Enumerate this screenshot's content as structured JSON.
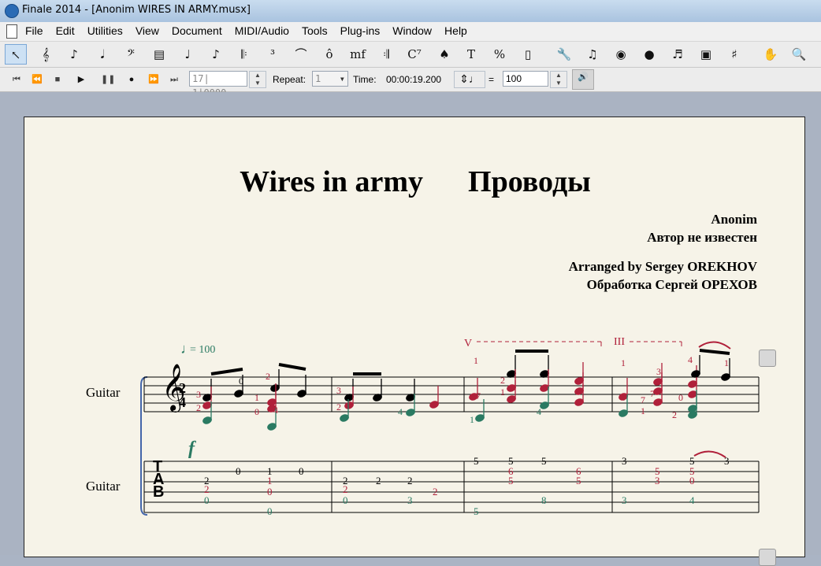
{
  "window": {
    "title": "Finale 2014 - [Anonim WIRES IN ARMY.musx]"
  },
  "menu": [
    "File",
    "Edit",
    "Utilities",
    "View",
    "Document",
    "MIDI/Audio",
    "Tools",
    "Plug-ins",
    "Window",
    "Help"
  ],
  "toolbar": {
    "tools": [
      {
        "name": "selection-tool",
        "glyph": "↖"
      },
      {
        "name": "staff-tool",
        "glyph": "𝄞"
      },
      {
        "name": "simple-entry-tool",
        "glyph": "♪"
      },
      {
        "name": "speedy-entry-tool",
        "glyph": "𝅘𝅥"
      },
      {
        "name": "clef-tool",
        "glyph": "𝄢"
      },
      {
        "name": "measure-tool",
        "glyph": "▤"
      },
      {
        "name": "note-tool",
        "glyph": "♩"
      },
      {
        "name": "articulation-tool",
        "glyph": "♪"
      },
      {
        "name": "repeat-tool",
        "glyph": "𝄆"
      },
      {
        "name": "tuplet-tool",
        "glyph": "³"
      },
      {
        "name": "smart-shape-tool",
        "glyph": "⌒"
      },
      {
        "name": "articulation-tool-2",
        "glyph": "ô"
      },
      {
        "name": "expression-tool",
        "glyph": "mf"
      },
      {
        "name": "repeat-bar-tool",
        "glyph": "𝄇"
      },
      {
        "name": "chord-tool",
        "glyph": "C⁷"
      },
      {
        "name": "lyrics-tool",
        "glyph": "♠"
      },
      {
        "name": "text-tool",
        "glyph": "T"
      },
      {
        "name": "resize-tool",
        "glyph": "%"
      },
      {
        "name": "page-layout-tool",
        "glyph": "▯"
      },
      {
        "name": "special-tools",
        "glyph": "🔧"
      },
      {
        "name": "midi-tool",
        "glyph": "♫"
      },
      {
        "name": "mirror-tool",
        "glyph": "◉"
      },
      {
        "name": "ossia-tool",
        "glyph": "●"
      },
      {
        "name": "graphics-tool",
        "glyph": "♬"
      },
      {
        "name": "hyperscribe-tool",
        "glyph": "▣"
      },
      {
        "name": "tempo-tool",
        "glyph": "♯"
      },
      {
        "name": "hand-grabber-tool",
        "glyph": "✋"
      },
      {
        "name": "zoom-tool",
        "glyph": "🔍"
      }
    ]
  },
  "playback": {
    "measure_field": "17| 1|0000",
    "repeat_label": "Repeat:",
    "repeat_value": "1",
    "time_label": "Time:",
    "time_value": "00:00:19.200",
    "equals": "=",
    "tempo_value": "100"
  },
  "score": {
    "title": "Wires in army      Проводы",
    "composer": "Anonim",
    "composer_ru": "Автор не известен",
    "arranger": "Arranged by Sergey OREKHOV",
    "arranger_ru": "Обработка Сергей ОРЕХОВ",
    "tempo_mark": "= 100",
    "instrument_staff": "Guitar",
    "instrument_tab": "Guitar",
    "dynamic": "f",
    "time_sig_top": "2",
    "time_sig_bottom": "4",
    "position_v": "V",
    "position_iii": "III",
    "tab_letters": [
      "T",
      "A",
      "B"
    ],
    "tab_numbers": [
      {
        "t": "0",
        "c": "b"
      },
      {
        "t": "1",
        "c": "b"
      },
      {
        "t": "0",
        "c": "b"
      },
      {
        "t": "2",
        "c": "b"
      },
      {
        "t": "2",
        "c": "r"
      },
      {
        "t": "0",
        "c": "g"
      },
      {
        "t": "1",
        "c": "r"
      },
      {
        "t": "0",
        "c": "r"
      },
      {
        "t": "0",
        "c": "g"
      },
      {
        "t": "2",
        "c": "b"
      },
      {
        "t": "2",
        "c": "r"
      },
      {
        "t": "0",
        "c": "g"
      },
      {
        "t": "2",
        "c": "b"
      },
      {
        "t": "2",
        "c": "b"
      },
      {
        "t": "3",
        "c": "g"
      },
      {
        "t": "2",
        "c": "r"
      },
      {
        "t": "5",
        "c": "b"
      },
      {
        "t": "5",
        "c": "g"
      },
      {
        "t": "5",
        "c": "b"
      },
      {
        "t": "6",
        "c": "r"
      },
      {
        "t": "5",
        "c": "r"
      },
      {
        "t": "5",
        "c": "b"
      },
      {
        "t": "8",
        "c": "g"
      },
      {
        "t": "6",
        "c": "r"
      },
      {
        "t": "5",
        "c": "r"
      },
      {
        "t": "3",
        "c": "b"
      },
      {
        "t": "3",
        "c": "g"
      },
      {
        "t": "5",
        "c": "r"
      },
      {
        "t": "3",
        "c": "r"
      },
      {
        "t": "5",
        "c": "b"
      },
      {
        "t": "5",
        "c": "r"
      },
      {
        "t": "0",
        "c": "r"
      },
      {
        "t": "4",
        "c": "g"
      },
      {
        "t": "3",
        "c": "b"
      }
    ],
    "finger_numbers": [
      {
        "t": "0",
        "c": "b"
      },
      {
        "t": "2",
        "c": "r"
      },
      {
        "t": "3",
        "c": "r"
      },
      {
        "t": "2",
        "c": "r"
      },
      {
        "t": "4",
        "c": "r"
      },
      {
        "t": "1",
        "c": "r"
      },
      {
        "t": "0",
        "c": "r"
      },
      {
        "t": "3",
        "c": "r"
      },
      {
        "t": "2",
        "c": "r"
      },
      {
        "t": "4",
        "c": "g"
      },
      {
        "t": "1",
        "c": "r"
      },
      {
        "t": "2",
        "c": "r"
      },
      {
        "t": "1",
        "c": "r"
      },
      {
        "t": "7",
        "c": "r"
      },
      {
        "t": "1",
        "c": "g"
      },
      {
        "t": "7",
        "c": "r"
      },
      {
        "t": "4",
        "c": "g"
      },
      {
        "t": "1",
        "c": "r"
      },
      {
        "t": "3",
        "c": "r"
      },
      {
        "t": "7",
        "c": "r"
      },
      {
        "t": "1",
        "c": "r"
      },
      {
        "t": "7",
        "c": "r"
      },
      {
        "t": "4",
        "c": "r"
      },
      {
        "t": "1",
        "c": "r"
      },
      {
        "t": "0",
        "c": "r"
      },
      {
        "t": "2",
        "c": "r"
      }
    ]
  },
  "colors": {
    "red": "#b0203a",
    "green": "#2a7a62",
    "black": "#000000"
  }
}
